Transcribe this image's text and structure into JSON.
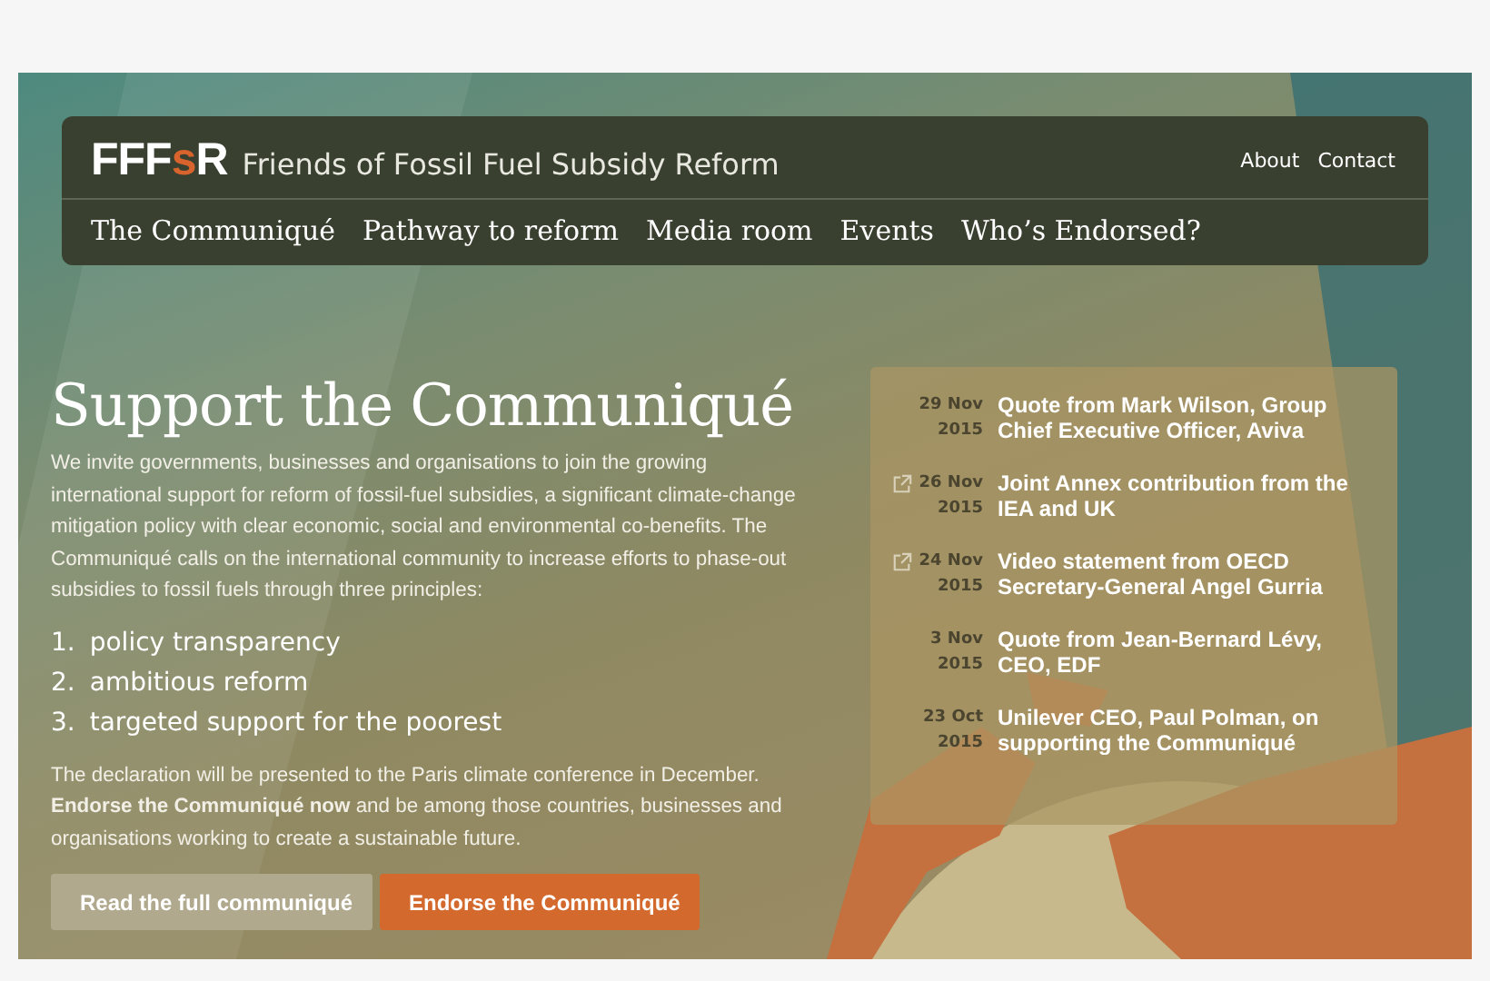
{
  "header": {
    "logo": [
      {
        "text": "FFF",
        "color": "#ffffff"
      },
      {
        "text": "s",
        "color": "#d9632c"
      },
      {
        "text": "R",
        "color": "#ffffff"
      }
    ],
    "site_name": "Friends of Fossil Fuel Subsidy Reform",
    "utility_links": [
      "About",
      "Contact"
    ],
    "nav": [
      "The Communiqué",
      "Pathway to reform",
      "Media room",
      "Events",
      "Who’s Endorsed?"
    ]
  },
  "hero": {
    "title": "Support the Communiqué",
    "intro": "We invite governments, businesses and organisations to join the growing international support for reform of fossil-fuel subsidies, a significant climate-change mitigation policy with clear economic, social and environmental co-benefits.  The Communiqué calls on the international community to increase efforts to phase-out subsidies to fossil fuels through three principles:",
    "principles": [
      {
        "number": "1.",
        "text": "policy transparency"
      },
      {
        "number": "2.",
        "text": "ambitious reform"
      },
      {
        "number": "3.",
        "text": "targeted support for the poorest"
      }
    ],
    "closing": "The declaration will be presented to the Paris climate conference in December. **Endorse the Communiqué now** and be among those countries, businesses and organisations working to create a sustainable future.",
    "buttons": [
      {
        "label": "Read the full communiqué",
        "kind": "secondary"
      },
      {
        "label": "Endorse the Communiqué",
        "kind": "primary"
      }
    ]
  },
  "news": [
    {
      "day": "29 Nov",
      "year": "2015",
      "title": "Quote from Mark Wilson, Group Chief Executive Officer, Aviva",
      "external": false
    },
    {
      "day": "26 Nov",
      "year": "2015",
      "title": "Joint Annex contribution from the IEA and UK",
      "external": true
    },
    {
      "day": "24 Nov",
      "year": "2015",
      "title": "Video statement from OECD Secretary-General Angel Gurria",
      "external": true
    },
    {
      "day": "3 Nov",
      "year": "2015",
      "title": "Quote from Jean-Bernard Lévy, CEO, EDF",
      "external": false
    },
    {
      "day": "23 Oct",
      "year": "2015",
      "title": "Unilever CEO, Paul Polman, on supporting the Communiqué",
      "external": false
    }
  ]
}
